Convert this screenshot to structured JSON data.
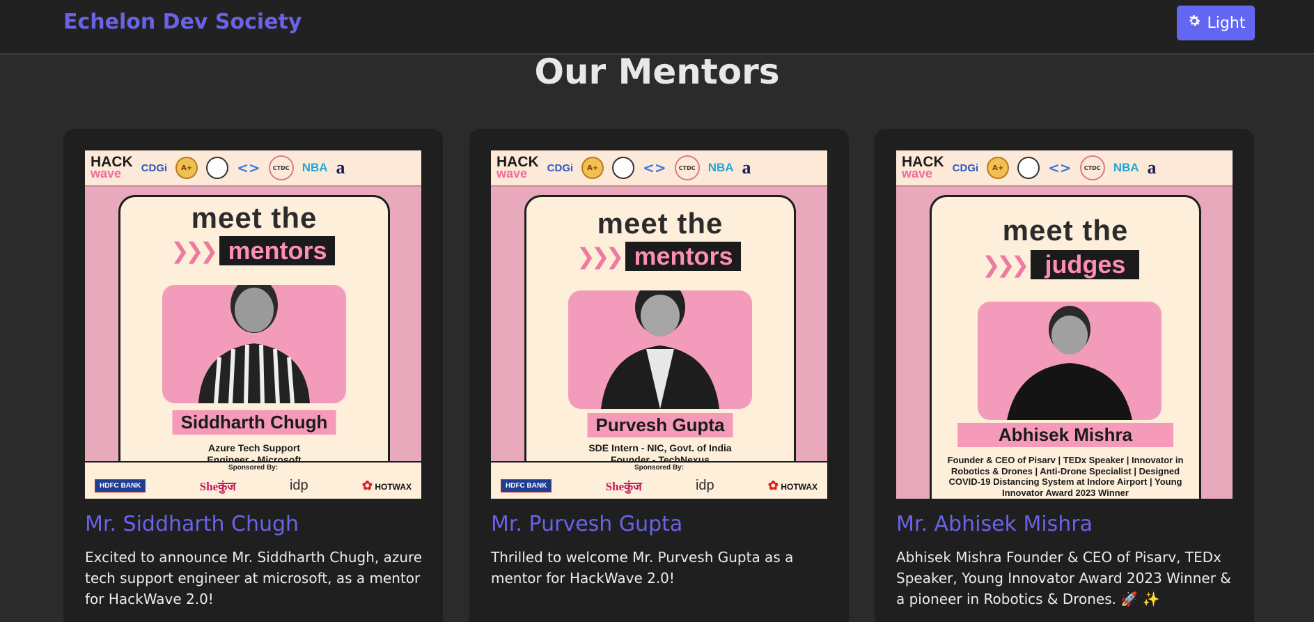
{
  "header": {
    "brand": "Echelon Dev Society",
    "theme_button_label": "Light",
    "theme_icon": "gear-icon"
  },
  "section": {
    "title": "Our Mentors"
  },
  "poster_common": {
    "hack_top": "HACK",
    "hack_bottom": "wave",
    "cdgi": "CDGi",
    "badge": "A+",
    "code": "<>",
    "ctdc": "CTDC",
    "nba": "NBA",
    "a_logo": "a",
    "sponsored_by": "Sponsored By:",
    "sponsors": [
      "HDFC BANK",
      "Sheकुंज",
      "idp",
      "HOTWAX"
    ]
  },
  "mentors": [
    {
      "poster_heading": "meet the",
      "poster_tag": "mentors",
      "poster_name": "Siddharth Chugh",
      "poster_role_1": "Azure Tech Support",
      "poster_role_2": "Engineer - Microsoft",
      "name": "Mr. Siddharth Chugh",
      "description": "Excited to announce Mr. Siddharth Chugh, azure tech support engineer at microsoft, as a mentor for HackWave 2.0!"
    },
    {
      "poster_heading": "meet the",
      "poster_tag": "mentors",
      "poster_name": "Purvesh Gupta",
      "poster_role_1": "SDE Intern - NIC, Govt. of India",
      "poster_role_2": "Founder - TechNexus",
      "name": "Mr. Purvesh Gupta",
      "description": "Thrilled to welcome Mr. Purvesh Gupta as a mentor for HackWave 2.0!"
    },
    {
      "poster_heading": "meet the",
      "poster_tag": "judges",
      "poster_name": "Abhisek Mishra",
      "poster_role_1": "Founder & CEO of Pisarv | TEDx Speaker | Innovator in Robotics & Drones | Anti-Drone Specialist | Designed COVID-19 Distancing System at Indore Airport |  Young Innovator Award 2023 Winner",
      "poster_role_2": "",
      "name": "Mr. Abhisek Mishra",
      "description": "Abhisek Mishra Founder & CEO of Pisarv, TEDx Speaker, Young Innovator Award 2023 Winner & a pioneer in Robotics & Drones. 🚀 ✨"
    }
  ],
  "colors": {
    "accent": "#6366f1",
    "brand_text": "#6a63e8",
    "background": "#2b2b2b",
    "card": "#1f1f1f",
    "poster_pink": "#f39bbb",
    "poster_cream": "#fdefda"
  }
}
